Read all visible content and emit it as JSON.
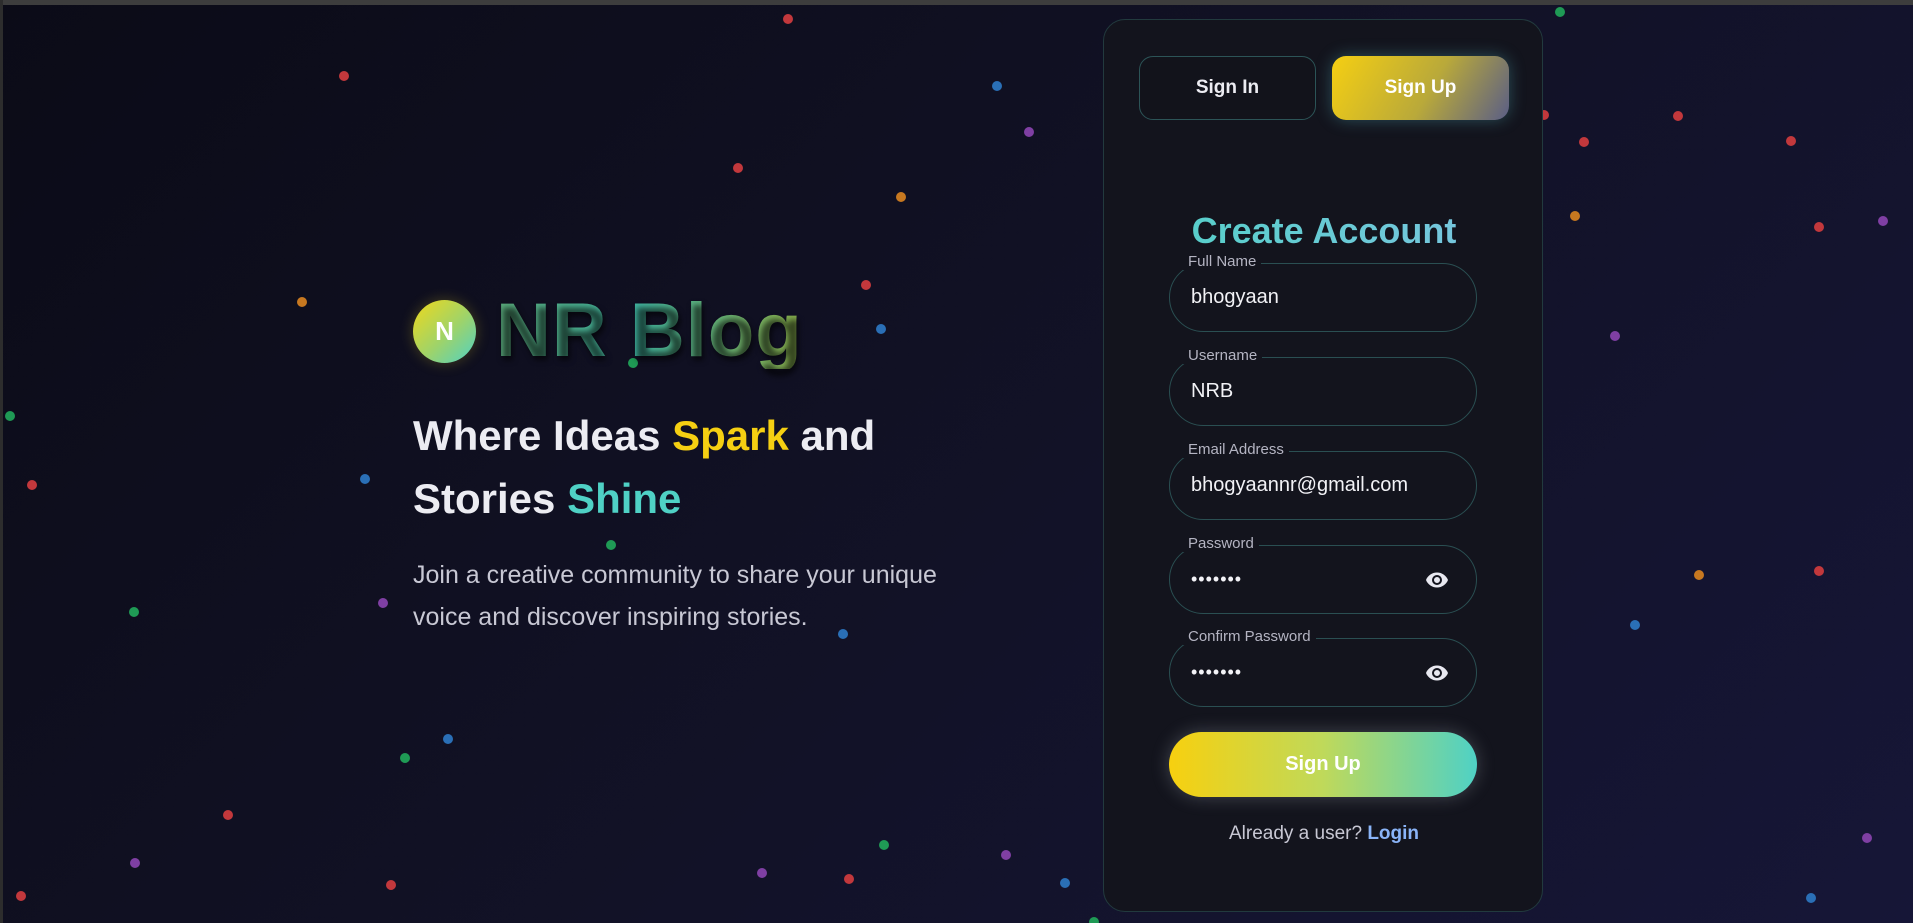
{
  "brand": {
    "logo_letter": "N",
    "name": "NR Blog"
  },
  "hero": {
    "headline_part1": "Where Ideas ",
    "headline_spark": "Spark",
    "headline_part2": " and",
    "headline_part3": "Stories ",
    "headline_shine": "Shine",
    "subtext": "Join a creative community to share your unique voice and discover inspiring stories."
  },
  "auth": {
    "tabs": {
      "signin": "Sign In",
      "signup": "Sign Up",
      "active": "signup"
    },
    "title": "Create Account",
    "fields": {
      "full_name": {
        "label": "Full Name",
        "value": "bhogyaan"
      },
      "username": {
        "label": "Username",
        "value": "NRB"
      },
      "email": {
        "label": "Email Address",
        "value": "bhogyaannr@gmail.com"
      },
      "password": {
        "label": "Password",
        "value": "•••••••"
      },
      "confirm_password": {
        "label": "Confirm Password",
        "value": "•••••••"
      }
    },
    "icons": {
      "password_toggle": "eye-icon",
      "confirm_toggle": "eye-icon"
    },
    "submit_label": "Sign Up",
    "footer_text": "Already a user? ",
    "footer_link": "Login"
  },
  "colors": {
    "accent_yellow": "#f5cf12",
    "accent_teal": "#4fd1c5",
    "link_blue": "#8ab4f8",
    "background": "#111124"
  }
}
